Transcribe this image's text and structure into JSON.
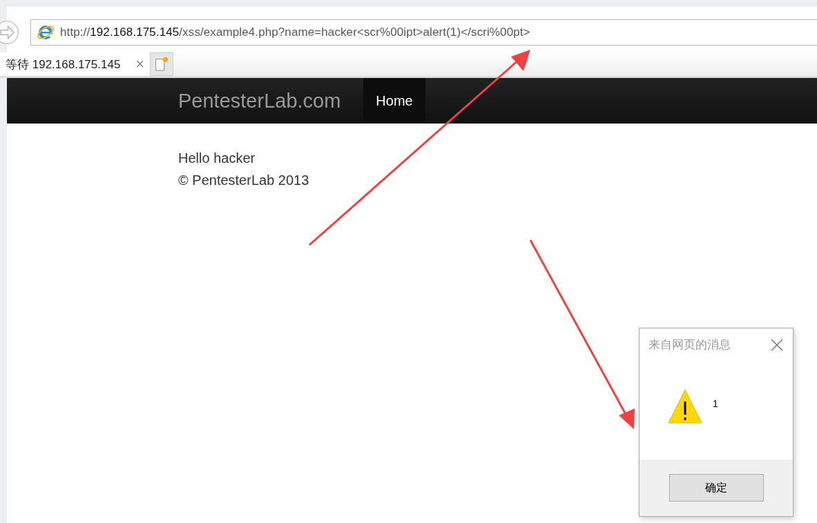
{
  "browser": {
    "url": "http://**192.168.175.145**/xss/example4.php?name=hacker<scr%00ipt>alert(1)</scri%00pt>",
    "tabs": [
      {
        "label": "等待 192.168.175.145",
        "close": "×"
      }
    ]
  },
  "navbar": {
    "brand": "PentesterLab.com",
    "items": [
      {
        "label": "Home",
        "selected": true
      }
    ]
  },
  "content": {
    "lines": [
      "Hello hacker",
      "© PentesterLab 2013"
    ]
  },
  "dialog": {
    "title": "来自网页的消息",
    "message": "1",
    "buttons": [
      "确定"
    ]
  }
}
